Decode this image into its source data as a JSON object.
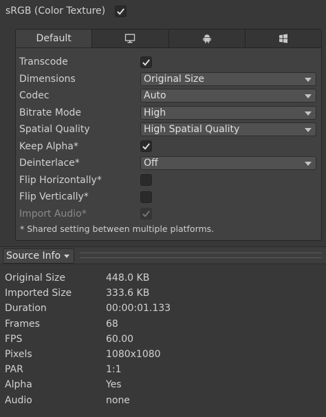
{
  "srgb": {
    "label": "sRGB (Color Texture)",
    "checked": true
  },
  "tabs": [
    {
      "label": "Default",
      "icon": "",
      "active": true
    },
    {
      "label": "",
      "icon": "monitor-icon",
      "active": false
    },
    {
      "label": "",
      "icon": "android-icon",
      "active": false
    },
    {
      "label": "",
      "icon": "windows-icon",
      "active": false
    }
  ],
  "settings": {
    "transcode": {
      "label": "Transcode",
      "checked": true
    },
    "dimensions": {
      "label": "Dimensions",
      "value": "Original Size"
    },
    "codec": {
      "label": "Codec",
      "value": "Auto"
    },
    "bitrate_mode": {
      "label": "Bitrate Mode",
      "value": "High"
    },
    "spatial_quality": {
      "label": "Spatial Quality",
      "value": "High Spatial Quality"
    },
    "keep_alpha": {
      "label": "Keep Alpha*",
      "checked": true
    },
    "deinterlace": {
      "label": "Deinterlace*",
      "value": "Off"
    },
    "flip_horizontally": {
      "label": "Flip Horizontally*",
      "checked": false
    },
    "flip_vertically": {
      "label": "Flip Vertically*",
      "checked": false
    },
    "import_audio": {
      "label": "Import Audio*",
      "checked": true,
      "disabled": true
    },
    "note": "* Shared setting between multiple platforms."
  },
  "source_info": {
    "title": "Source Info",
    "rows": [
      {
        "key": "Original Size",
        "value": "448.0 KB"
      },
      {
        "key": "Imported Size",
        "value": "333.6 KB"
      },
      {
        "key": "Duration",
        "value": "00:00:01.133"
      },
      {
        "key": "Frames",
        "value": "68"
      },
      {
        "key": "FPS",
        "value": "60.00"
      },
      {
        "key": "Pixels",
        "value": "1080x1080"
      },
      {
        "key": "PAR",
        "value": "1:1"
      },
      {
        "key": "Alpha",
        "value": "Yes"
      },
      {
        "key": "Audio",
        "value": "none"
      }
    ]
  }
}
